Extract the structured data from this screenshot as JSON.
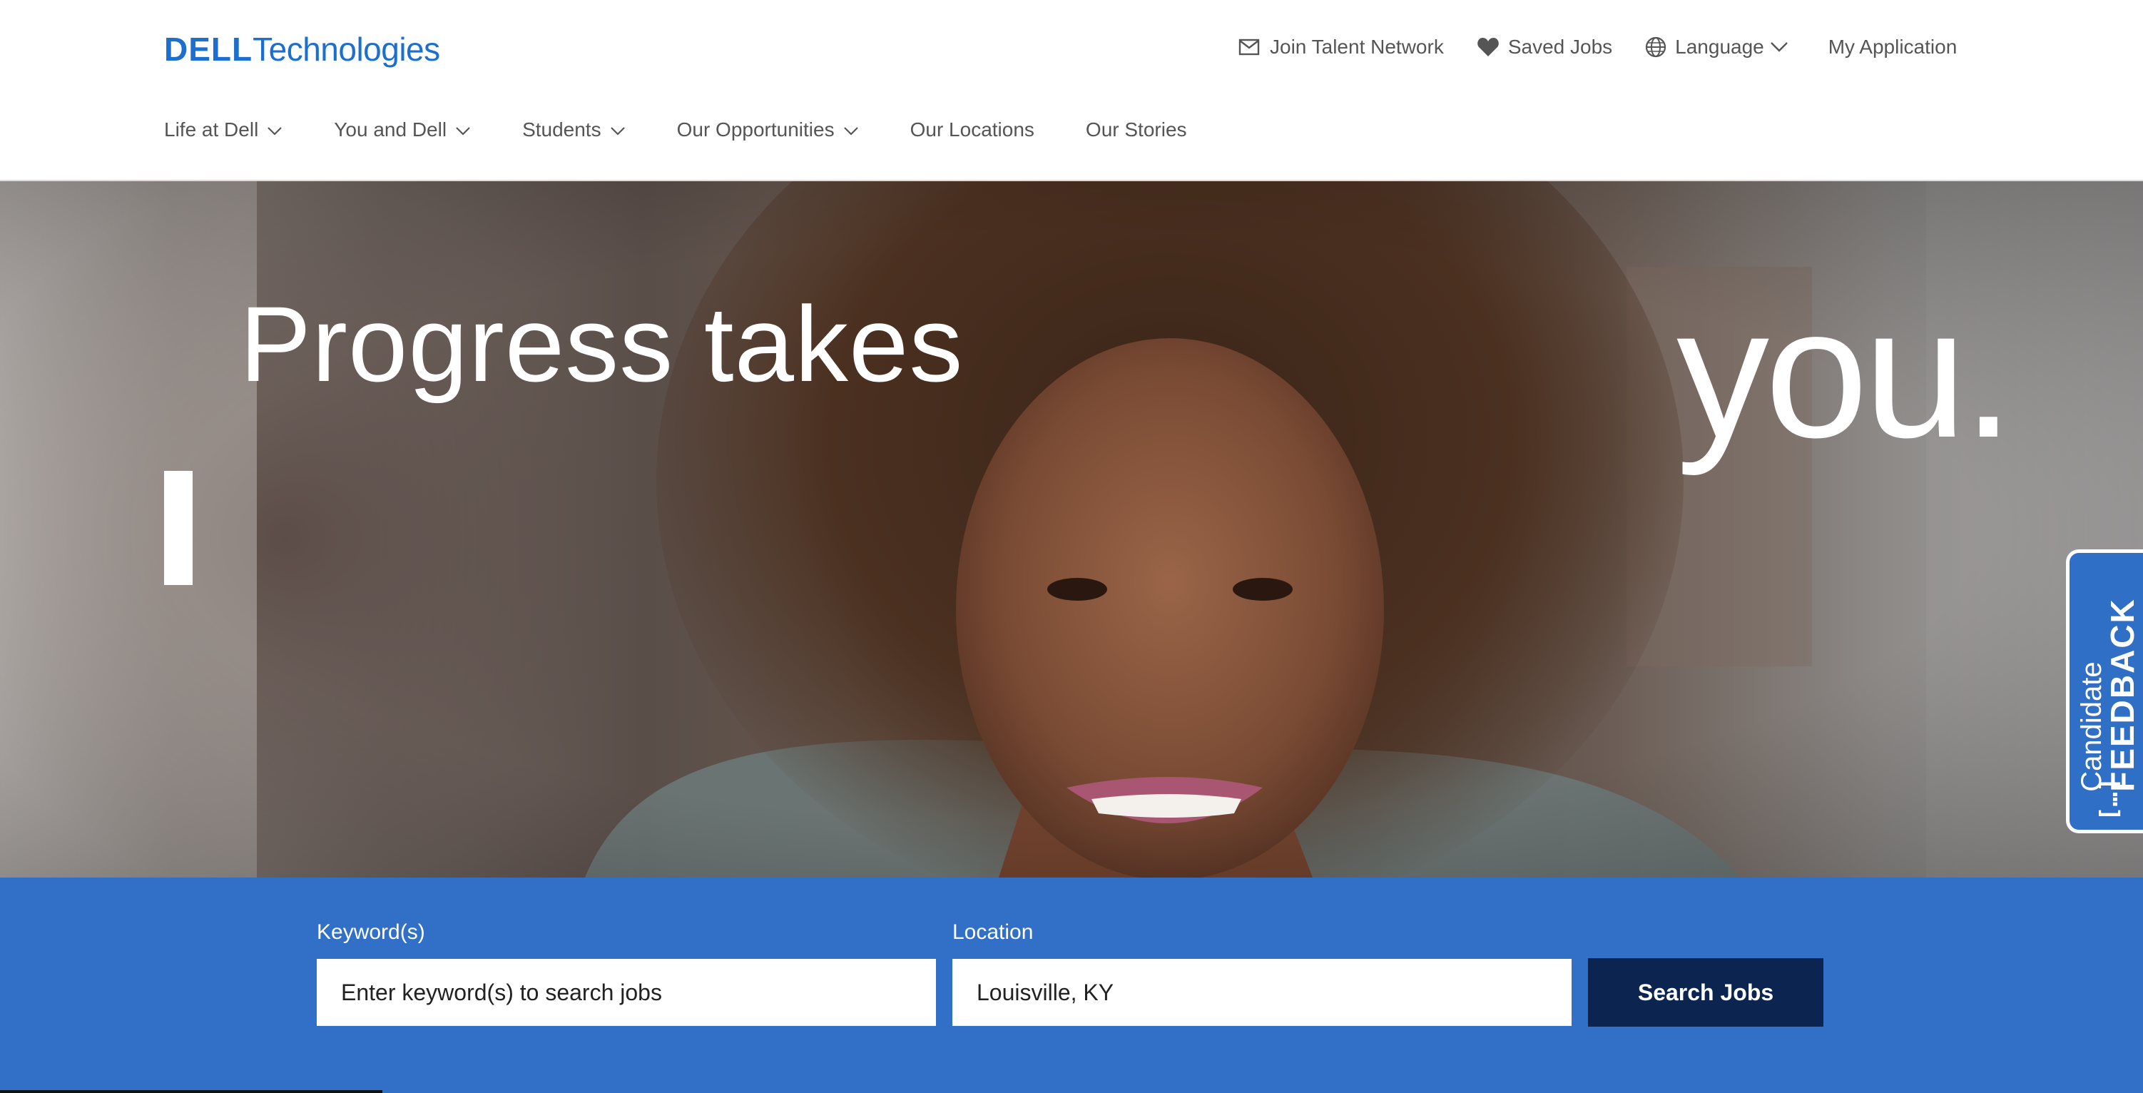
{
  "brand": {
    "logo_part1": "DELL",
    "logo_part2": "Technologies",
    "color": "#1d6fcf"
  },
  "utility_nav": [
    {
      "label": "Join Talent Network",
      "icon": "envelope-icon"
    },
    {
      "label": "Saved Jobs",
      "icon": "heart-icon"
    },
    {
      "label": "Language",
      "icon": "globe-icon"
    },
    {
      "label": "My Application"
    }
  ],
  "main_nav": [
    {
      "label": "Life at Dell",
      "has_dropdown": true
    },
    {
      "label": "You and Dell",
      "has_dropdown": true
    },
    {
      "label": "Students",
      "has_dropdown": true
    },
    {
      "label": "Our Opportunities",
      "has_dropdown": true
    },
    {
      "label": "Our Locations",
      "has_dropdown": false
    },
    {
      "label": "Our Stories",
      "has_dropdown": false
    }
  ],
  "hero": {
    "line_left": "Progress takes",
    "line_right": "you."
  },
  "feedback": {
    "line1": "Candidate",
    "line2": "FEEDBACK",
    "icon": "[…]"
  },
  "search": {
    "keyword_label": "Keyword(s)",
    "keyword_placeholder": "Enter keyword(s) to search jobs",
    "location_label": "Location",
    "location_value": "Louisville, KY",
    "button_label": "Search Jobs",
    "band_color": "#3170c6",
    "button_color": "#0b2550"
  }
}
